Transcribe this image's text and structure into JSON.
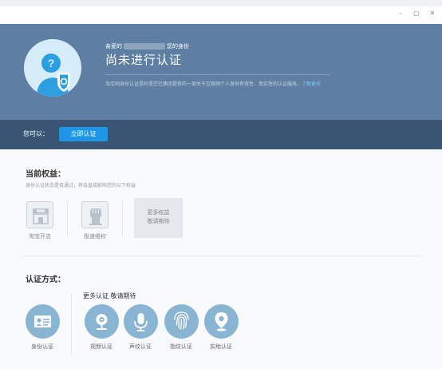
{
  "window": {
    "controls": {
      "minimize": "–",
      "maximize": "□",
      "close": "✕"
    }
  },
  "header": {
    "greeting_prefix": "亲爱的",
    "greeting_suffix": "您的身份",
    "status": "尚未进行认证",
    "description": "淘宝网身份认证是阿里巴巴集团提供的一项关于互联网个人身份有效性、真实性的认证服务。",
    "learn_more": "了解更多"
  },
  "action_bar": {
    "label": "您可以：",
    "button": "立即认证"
  },
  "benefits": {
    "title": "当前权益：",
    "subtitle": "身份认证状态是否通过，将会直接影响您的以下权益",
    "items": [
      {
        "label": "淘宝开店",
        "icon": "shop-icon"
      },
      {
        "label": "极速维权",
        "icon": "fist-icon"
      }
    ],
    "more_line1": "更多权益",
    "more_line2": "敬请期待"
  },
  "methods": {
    "title": "认证方式：",
    "more_label": "更多认证 敬请期待",
    "items": [
      {
        "label": "身份认证",
        "icon": "id-card-icon"
      },
      {
        "label": "视频认证",
        "icon": "camera-icon"
      },
      {
        "label": "声纹认证",
        "icon": "microphone-icon"
      },
      {
        "label": "指纹认证",
        "icon": "fingerprint-icon"
      },
      {
        "label": "实地认证",
        "icon": "location-pin-icon"
      }
    ]
  },
  "colors": {
    "header_bg": "#5e7fa3",
    "action_bar_bg": "#3a5573",
    "button_bg": "#1e96e8",
    "method_circle": "#89b5d3"
  }
}
